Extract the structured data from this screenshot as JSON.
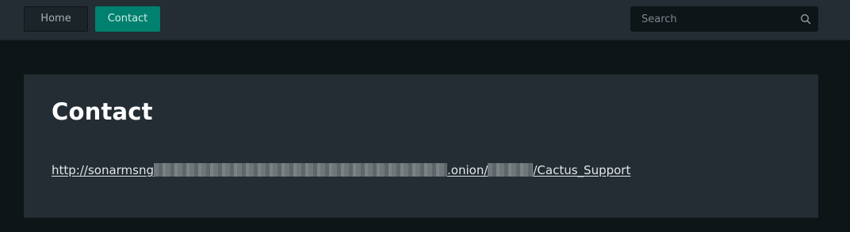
{
  "nav": {
    "home_label": "Home",
    "contact_label": "Contact",
    "active": "Contact"
  },
  "search": {
    "placeholder": "Search",
    "value": "",
    "icon": "search-icon"
  },
  "main": {
    "title": "Contact",
    "link": {
      "prefix": "http://sonarmsng",
      "middle": ".onion/",
      "suffix": "/Cactus_Support",
      "redacted_segments": 2
    }
  },
  "colors": {
    "topbar_bg": "#232d33",
    "page_bg": "#0e1517",
    "card_bg": "#232d33",
    "accent": "#00806e",
    "title_text": "#ffffff"
  }
}
